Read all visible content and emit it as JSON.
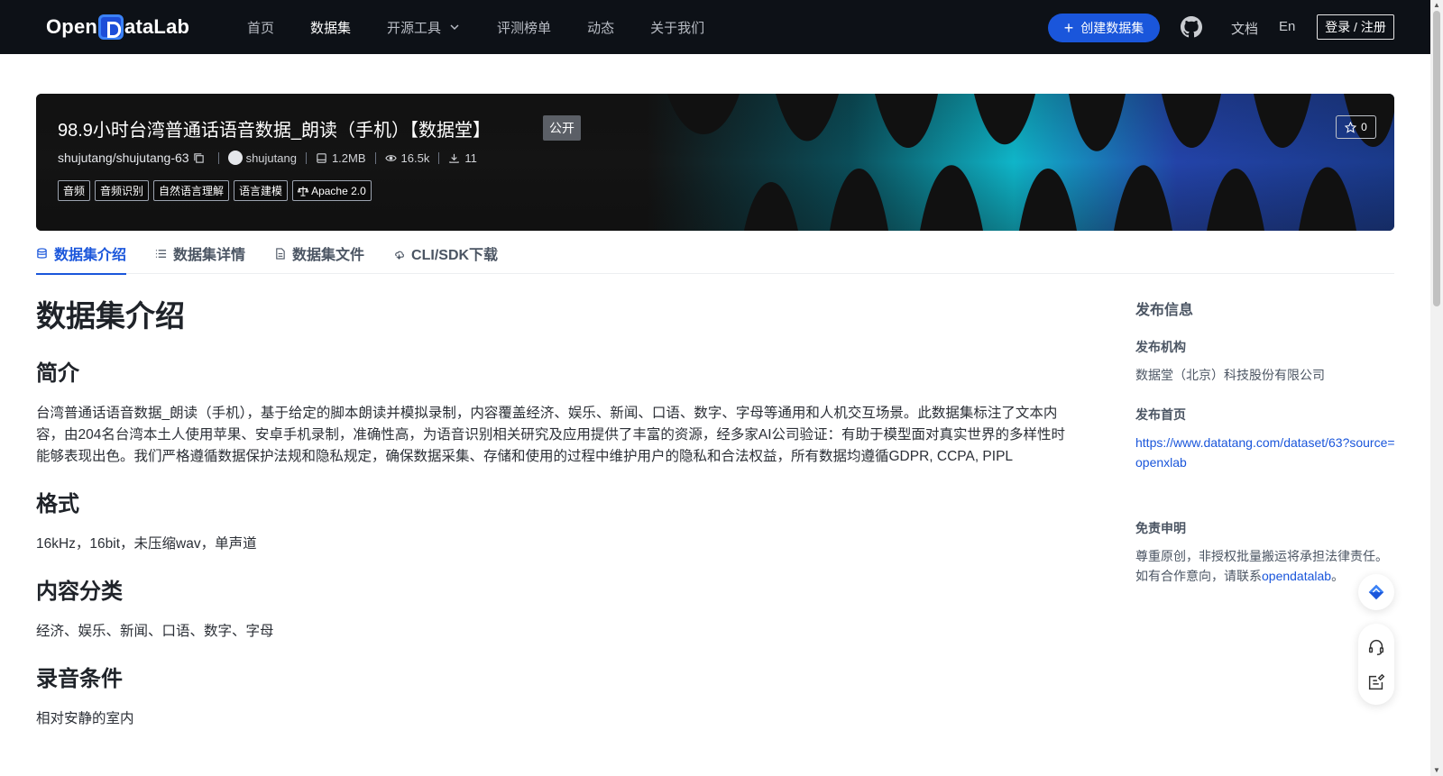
{
  "nav": {
    "logo_text_a": "Open",
    "logo_text_b": "ataLab",
    "links": [
      "首页",
      "数据集",
      "开源工具",
      "评测榜单",
      "动态",
      "关于我们"
    ],
    "create_label": "创建数据集",
    "docs_label": "文档",
    "lang_label": "En",
    "login_label": "登录 / 注册"
  },
  "banner": {
    "title": "98.9小时台湾普通话语音数据_朗读（手机）【数据堂】",
    "visibility": "公开",
    "repo": "shujutang/shujutang-63",
    "owner": "shujutang",
    "size": "1.2MB",
    "views": "16.5k",
    "downloads": "11",
    "tags": [
      "音频",
      "音频识别",
      "自然语言理解",
      "语言建模"
    ],
    "license": "Apache 2.0",
    "stars": "0"
  },
  "tabs": [
    "数据集介绍",
    "数据集详情",
    "数据集文件",
    "CLI/SDK下载"
  ],
  "content": {
    "h1": "数据集介绍",
    "sections": [
      {
        "title": "简介",
        "text": "台湾普通话语音数据_朗读（手机），基于给定的脚本朗读并模拟录制，内容覆盖经济、娱乐、新闻、口语、数字、字母等通用和人机交互场景。此数据集标注了文本内容，由204名台湾本土人使用苹果、安卓手机录制，准确性高，为语音识别相关研究及应用提供了丰富的资源，经多家AI公司验证：有助于模型面对真实世界的多样性时能够表现出色。我们严格遵循数据保护法规和隐私规定，确保数据采集、存储和使用的过程中维护用户的隐私和合法权益，所有数据均遵循GDPR, CCPA, PIPL"
      },
      {
        "title": "格式",
        "text": "16kHz，16bit，未压缩wav，单声道"
      },
      {
        "title": "内容分类",
        "text": "经济、娱乐、新闻、口语、数字、字母"
      },
      {
        "title": "录音条件",
        "text": "相对安静的室内"
      }
    ]
  },
  "sidebar": {
    "title": "发布信息",
    "org_label": "发布机构",
    "org_value": "数据堂（北京）科技股份有限公司",
    "home_label": "发布首页",
    "home_url": "https://www.datatang.com/dataset/63?source=openxlab",
    "disclaimer_label": "免责申明",
    "disclaimer_text": "尊重原创，非授权批量搬运将承担法律责任。如有合作意向，请联系",
    "disclaimer_link": "opendatalab",
    "disclaimer_end": "。"
  },
  "colors": {
    "nav_bg": "#0d1117",
    "accent": "#1a56db",
    "banner_wave_cyan": "#0fb5c9",
    "banner_wave_blue": "#2343a8"
  },
  "icons": [
    "plus-icon",
    "github-icon",
    "copy-icon",
    "disk-icon",
    "eye-icon",
    "download-icon",
    "license-icon",
    "star-icon",
    "database-icon",
    "list-icon",
    "file-icon",
    "cloud-icon",
    "diamond-icon",
    "headset-icon",
    "feedback-icon"
  ]
}
